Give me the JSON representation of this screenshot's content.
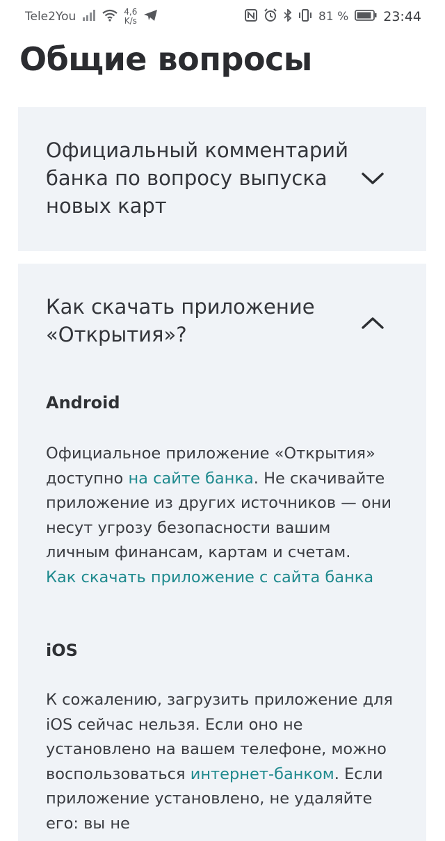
{
  "status_bar": {
    "carrier": "Tele2You",
    "speed_value": "4,6",
    "speed_unit": "K/s",
    "battery_percent": "81 %",
    "time": "23:44"
  },
  "page": {
    "title": "Общие вопросы"
  },
  "faq": [
    {
      "question": "Официальный комментарий банка по вопросу выпуска новых карт",
      "state": "collapsed"
    },
    {
      "question": "Как скачать приложение «Открытия»?",
      "state": "expanded",
      "android": {
        "heading": "Android",
        "text_1": "Официальное приложение «Открытия» доступно ",
        "link_1": "на сайте банка",
        "text_2": ". Не скачивайте приложение из других источников — они несут угрозу безопасности вашим личным финансам, картам и счетам.",
        "link_2": "Как скачать приложение с сайта банка"
      },
      "ios": {
        "heading": "iOS",
        "text_1": "К сожалению, загрузить приложение для iOS сейчас нельзя. Если оно не установлено на вашем телефоне, можно воспользоваться ",
        "link_1": "интернет-банком",
        "text_2": ". Если приложение установлено, не удаляйте его: вы не"
      }
    }
  ],
  "colors": {
    "card_bg": "#f0f3f7",
    "link": "#1f8a8e",
    "text": "#33353a"
  },
  "icons": {
    "chevron_collapsed": "chevron-down-icon",
    "chevron_expanded": "chevron-up-icon"
  }
}
